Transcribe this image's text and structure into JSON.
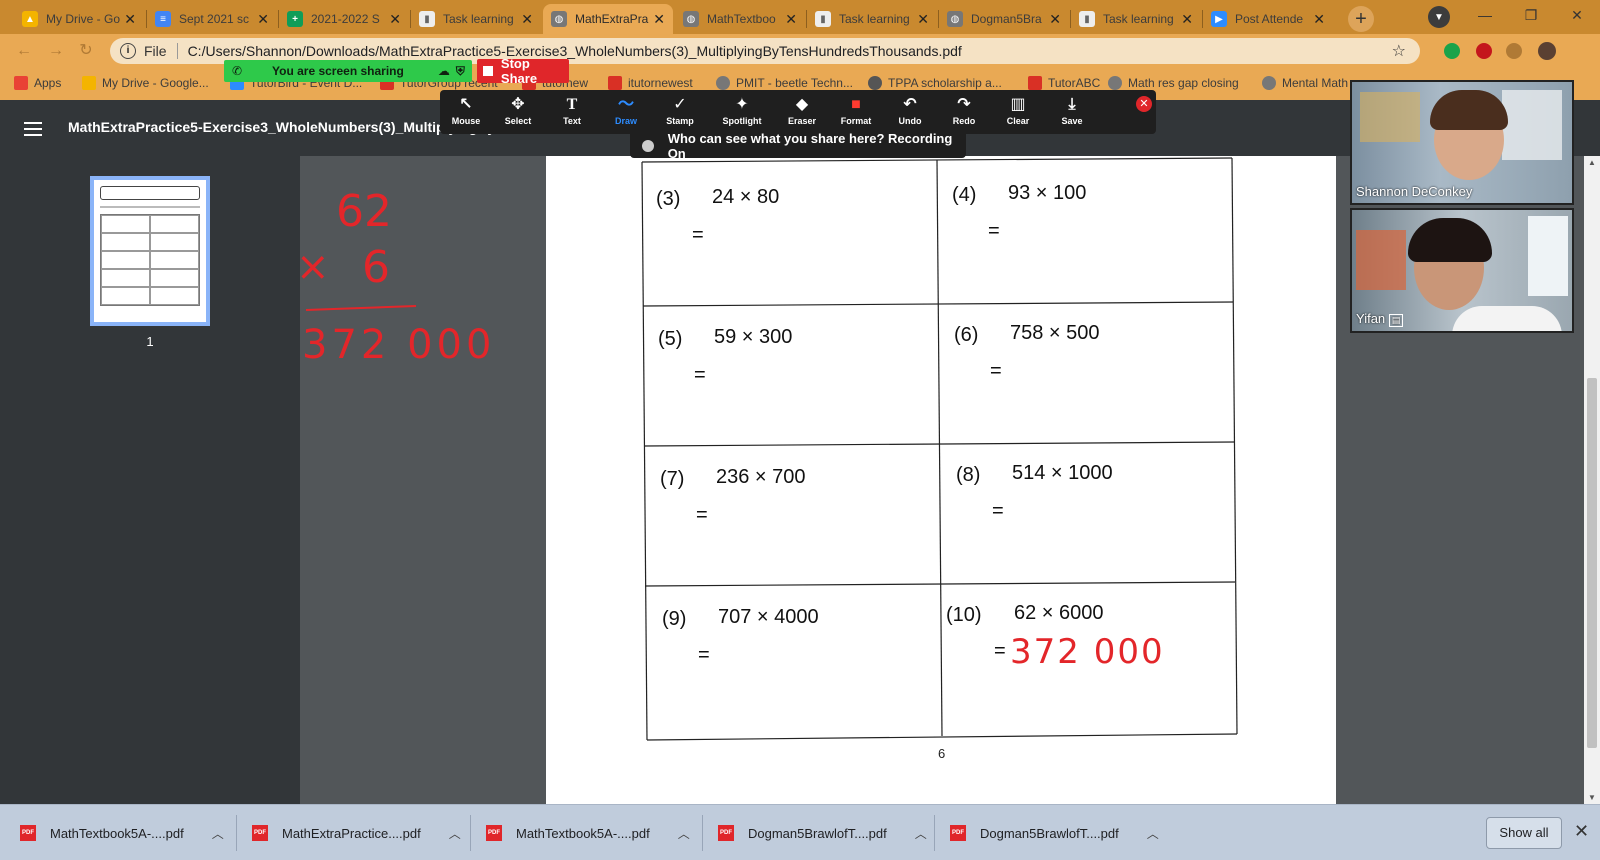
{
  "tabs": [
    {
      "title": "My Drive - Go",
      "fav": "drive-icon",
      "color": "#f4b400"
    },
    {
      "title": "Sept 2021 sc",
      "fav": "docs-icon",
      "color": "#4285f4"
    },
    {
      "title": "2021-2022 S",
      "fav": "sheets-icon",
      "color": "#0f9d58"
    },
    {
      "title": "Task learning",
      "fav": "task-icon",
      "color": "#c9c9c9"
    },
    {
      "title": "MathExtraPra",
      "fav": "globe-icon",
      "color": "#777777"
    },
    {
      "title": "MathTextboo",
      "fav": "globe-icon",
      "color": "#777777"
    },
    {
      "title": "Task learning",
      "fav": "task-icon",
      "color": "#c9c9c9"
    },
    {
      "title": "Dogman5Bra",
      "fav": "globe-icon",
      "color": "#777777"
    },
    {
      "title": "Task learning",
      "fav": "task-icon",
      "color": "#c9c9c9"
    },
    {
      "title": "Post Attende",
      "fav": "zoom-icon",
      "color": "#2d8cff"
    }
  ],
  "address": {
    "scheme": "File",
    "url": "C:/Users/Shannon/Downloads/MathExtraPractice5-Exercise3_WholeNumbers(3)_MultiplyingByTensHundredsThousands.pdf"
  },
  "bookmarks": [
    {
      "label": "Apps",
      "color": "#e94235"
    },
    {
      "label": "My Drive - Google...",
      "color": "#f4b400"
    },
    {
      "label": "TutorBird - Event D...",
      "color": "#2d8cff"
    },
    {
      "label": "TutorGroup recent",
      "color": "#d93025"
    },
    {
      "label": "tutornew",
      "color": "#d93025"
    },
    {
      "label": "itutornewest",
      "color": "#d93025"
    },
    {
      "label": "PMIT - beetle Techn...",
      "color": "#777777"
    },
    {
      "label": "TPPA scholarship a...",
      "color": "#555555"
    },
    {
      "label": "TutorABC",
      "color": "#d93025"
    },
    {
      "label": "Math res gap closing",
      "color": "#777777"
    },
    {
      "label": "Mental Math",
      "color": "#777777"
    }
  ],
  "share": {
    "banner": "You are screen sharing",
    "stop": "Stop Share",
    "who": "Who can see what you share here? Recording On"
  },
  "tools": [
    {
      "label": "Mouse",
      "icon": "mouse-icon",
      "glyph": "↖"
    },
    {
      "label": "Select",
      "icon": "select-icon",
      "glyph": "✥"
    },
    {
      "label": "Text",
      "icon": "text-icon",
      "glyph": "T"
    },
    {
      "label": "Draw",
      "icon": "draw-icon",
      "glyph": "〜"
    },
    {
      "label": "Stamp",
      "icon": "stamp-icon",
      "glyph": "✓"
    },
    {
      "label": "Spotlight",
      "icon": "spotlight-icon",
      "glyph": "✦"
    },
    {
      "label": "Eraser",
      "icon": "eraser-icon",
      "glyph": "◆"
    },
    {
      "label": "Format",
      "icon": "format-icon",
      "glyph": "■"
    },
    {
      "label": "Undo",
      "icon": "undo-icon",
      "glyph": "↶"
    },
    {
      "label": "Redo",
      "icon": "redo-icon",
      "glyph": "↷"
    },
    {
      "label": "Clear",
      "icon": "trash-icon",
      "glyph": "🗑"
    },
    {
      "label": "Save",
      "icon": "save-icon",
      "glyph": "⤓"
    }
  ],
  "pdf": {
    "title": "MathExtraPractice5-Exercise3_WholeNumbers(3)_MultiplyingByTensHundredsThousand...",
    "thumb_label": "1",
    "page_number": "6"
  },
  "problems": [
    {
      "num": "(3)",
      "expr": "24 × 80",
      "eq": "="
    },
    {
      "num": "(4)",
      "expr": "93 × 100",
      "eq": "="
    },
    {
      "num": "(5)",
      "expr": "59 × 300",
      "eq": "="
    },
    {
      "num": "(6)",
      "expr": "758 × 500",
      "eq": "="
    },
    {
      "num": "(7)",
      "expr": "236 × 700",
      "eq": "="
    },
    {
      "num": "(8)",
      "expr": "514 × 1000",
      "eq": "="
    },
    {
      "num": "(9)",
      "expr": "707 × 4000",
      "eq": "="
    },
    {
      "num": "(10)",
      "expr": "62 × 6000",
      "eq": "="
    }
  ],
  "annotations": {
    "answer": "372 000",
    "work_top": "62",
    "work_times": "×",
    "work_mult": "6",
    "work_result": "372 000"
  },
  "participants": [
    {
      "name": "Shannon DeConkey"
    },
    {
      "name": "Yifan"
    }
  ],
  "downloads": [
    {
      "name": "MathTextbook5A-....pdf"
    },
    {
      "name": "MathExtraPractice....pdf"
    },
    {
      "name": "MathTextbook5A-....pdf"
    },
    {
      "name": "Dogman5BrawlofT....pdf"
    },
    {
      "name": "Dogman5BrawlofT....pdf"
    }
  ],
  "downloads_show_all": "Show all",
  "colors": {
    "ink": "#e3262a",
    "accent": "#2d8cff",
    "tab_strip": "#c9892f"
  }
}
